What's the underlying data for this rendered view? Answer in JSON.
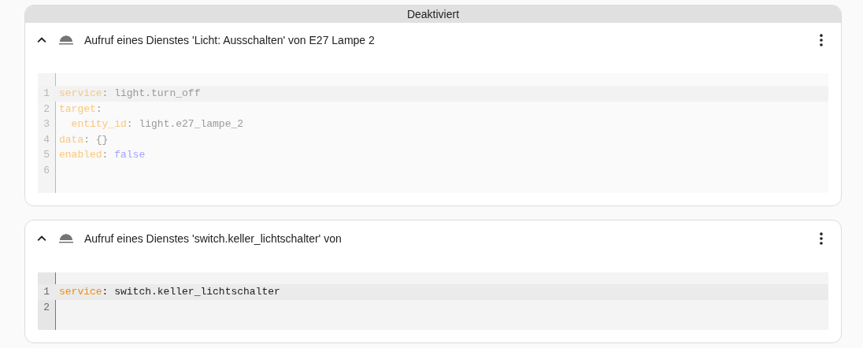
{
  "cards": [
    {
      "disabled": true,
      "badge": "Deaktiviert",
      "expanded": true,
      "title": "Aufruf eines Dienstes 'Licht: Ausschalten' von E27 Lampe 2",
      "code": [
        {
          "number": "1",
          "active": true,
          "tokens": [
            {
              "kind": "key",
              "text": "service"
            },
            {
              "kind": "plain",
              "text": ": light.turn_off"
            }
          ]
        },
        {
          "number": "2",
          "active": false,
          "tokens": [
            {
              "kind": "key",
              "text": "target"
            },
            {
              "kind": "plain",
              "text": ":"
            }
          ]
        },
        {
          "number": "3",
          "active": false,
          "tokens": [
            {
              "kind": "key",
              "text": "  entity_id"
            },
            {
              "kind": "plain",
              "text": ": light.e27_lampe_2"
            }
          ]
        },
        {
          "number": "4",
          "active": false,
          "tokens": [
            {
              "kind": "key",
              "text": "data"
            },
            {
              "kind": "plain",
              "text": ": {}"
            }
          ]
        },
        {
          "number": "5",
          "active": false,
          "tokens": [
            {
              "kind": "key",
              "text": "enabled"
            },
            {
              "kind": "plain",
              "text": ": "
            },
            {
              "kind": "bool",
              "text": "false"
            }
          ]
        },
        {
          "number": "6",
          "active": false
        }
      ]
    },
    {
      "disabled": false,
      "expanded": true,
      "title": "Aufruf eines Dienstes 'switch.keller_lichtschalter' von",
      "code": [
        {
          "number": "1",
          "active": true,
          "tokens": [
            {
              "kind": "key",
              "text": "service"
            },
            {
              "kind": "plain",
              "text": ": switch.keller_lichtschalter"
            }
          ]
        },
        {
          "number": "2",
          "active": false
        }
      ]
    }
  ]
}
